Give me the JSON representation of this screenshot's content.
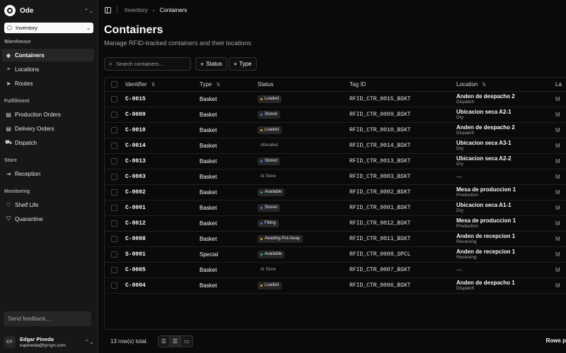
{
  "app": {
    "name": "Ode",
    "brand_logo_icon": "ode-logo-icon"
  },
  "selector": {
    "label": "Inventory",
    "icon": "cube-icon"
  },
  "sidebar": {
    "sections": [
      {
        "title": "Warehouse",
        "items": [
          {
            "label": "Containers",
            "icon": "box-icon",
            "active": true
          },
          {
            "label": "Locations",
            "icon": "map-pin-icon"
          },
          {
            "label": "Routes",
            "icon": "navigation-icon"
          }
        ]
      },
      {
        "title": "Fulfillment",
        "items": [
          {
            "label": "Production Orders",
            "icon": "document-icon"
          },
          {
            "label": "Delivery Orders",
            "icon": "document-icon"
          },
          {
            "label": "Dispatch",
            "icon": "truck-icon"
          }
        ]
      },
      {
        "title": "Store",
        "items": [
          {
            "label": "Reception",
            "icon": "inbox-icon"
          }
        ]
      },
      {
        "title": "Monitoring",
        "items": [
          {
            "label": "Shelf Life",
            "icon": "heart-pulse-icon"
          },
          {
            "label": "Quarantine",
            "icon": "shield-alert-icon"
          }
        ]
      }
    ],
    "feedback_placeholder": "Send feedback...",
    "user": {
      "initials": "EP",
      "name": "Edgar Pineda",
      "email": "eapineda@tyrsyn.com"
    }
  },
  "breadcrumb": {
    "parent": "Inventory",
    "current": "Containers"
  },
  "page": {
    "title": "Containers",
    "subtitle": "Manage RFID-tracked containers and their locations"
  },
  "search": {
    "placeholder": "Search containers..."
  },
  "filters": {
    "status_label": "Status",
    "type_label": "Type"
  },
  "table": {
    "columns": {
      "identifier": "Identifier",
      "type": "Type",
      "status": "Status",
      "tag_id": "Tag ID",
      "location": "Location",
      "last": "La"
    },
    "rows": [
      {
        "id": "C-0015",
        "type": "Basket",
        "status": "Loaded",
        "tag": "RFID_CTR_0015_BSKT",
        "loc": "Anden de despacho 2",
        "loc_sub": "Dispatch",
        "last": "M"
      },
      {
        "id": "C-0009",
        "type": "Basket",
        "status": "Stored",
        "tag": "RFID_CTR_0009_BSKT",
        "loc": "Ubicacion seca A2-1",
        "loc_sub": "Dry",
        "last": "M"
      },
      {
        "id": "C-0010",
        "type": "Basket",
        "status": "Loaded",
        "tag": "RFID_CTR_0010_BSKT",
        "loc": "Anden de despacho 2",
        "loc_sub": "Dispatch",
        "last": "M"
      },
      {
        "id": "C-0014",
        "type": "Basket",
        "status": "Allocated",
        "tag": "RFID_CTR_0014_BSKT",
        "loc": "Ubicacion seca A3-1",
        "loc_sub": "Dry",
        "last": "M"
      },
      {
        "id": "C-0013",
        "type": "Basket",
        "status": "Stored",
        "tag": "RFID_CTR_0013_BSKT",
        "loc": "Ubicacion seca A2-2",
        "loc_sub": "Dry",
        "last": "M"
      },
      {
        "id": "C-0003",
        "type": "Basket",
        "status": "At Store",
        "tag": "RFID_CTR_0003_BSKT",
        "loc": "—",
        "loc_sub": "",
        "last": "M"
      },
      {
        "id": "C-0002",
        "type": "Basket",
        "status": "Available",
        "tag": "RFID_CTR_0002_BSKT",
        "loc": "Mesa de produccion 1",
        "loc_sub": "Production",
        "last": "M"
      },
      {
        "id": "C-0001",
        "type": "Basket",
        "status": "Stored",
        "tag": "RFID_CTR_0001_BSKT",
        "loc": "Ubicacion seca A1-1",
        "loc_sub": "Dry",
        "last": "M"
      },
      {
        "id": "C-0012",
        "type": "Basket",
        "status": "Filling",
        "tag": "RFID_CTR_0012_BSKT",
        "loc": "Mesa de produccion 1",
        "loc_sub": "Production",
        "last": "M"
      },
      {
        "id": "C-0008",
        "type": "Basket",
        "status": "Awaiting Put-Away",
        "tag": "RFID_CTR_0011_BSKT",
        "loc": "Anden de recepcion 1",
        "loc_sub": "Receiving",
        "last": "M"
      },
      {
        "id": "S-0001",
        "type": "Special",
        "status": "Available",
        "tag": "RFID_CTR_0008_SPCL",
        "loc": "Anden de recepcion 1",
        "loc_sub": "Receiving",
        "last": "M"
      },
      {
        "id": "C-0005",
        "type": "Basket",
        "status": "At Store",
        "tag": "RFID_CTR_0007_BSKT",
        "loc": "—",
        "loc_sub": "",
        "last": "M"
      },
      {
        "id": "C-0004",
        "type": "Basket",
        "status": "Loaded",
        "tag": "RFID_CTR_0006_BSKT",
        "loc": "Anden de despacho 1",
        "loc_sub": "Dispatch",
        "last": "M"
      }
    ]
  },
  "status_colors": {
    "Loaded": "#f59e0b",
    "Stored": "#3b82f6",
    "Available": "#22c55e",
    "Filling": "#3b82f6",
    "Awaiting Put-Away": "#f59e0b"
  },
  "footer": {
    "row_count": "13 row(s) total.",
    "rows_per_page_label": "Rows p",
    "view_icons": [
      "rows-compact-icon",
      "rows-default-icon",
      "rows-spacious-icon"
    ]
  }
}
